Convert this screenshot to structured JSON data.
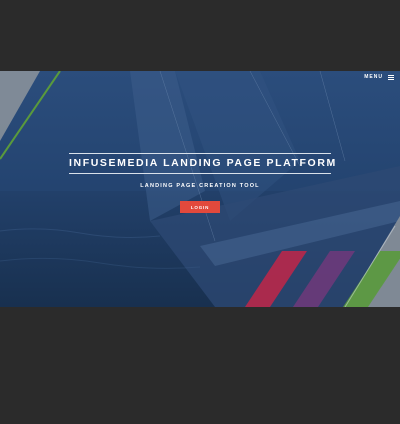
{
  "header": {
    "menu_label": "MENU"
  },
  "hero": {
    "title": "INFUSEMEDIA LANDING PAGE PLATFORM",
    "subtitle": "LANDING PAGE CREATION TOOL",
    "login_label": "LOGIN"
  },
  "icons": {
    "menu": "hamburger-icon"
  },
  "colors": {
    "page_background": "#2b2b2b",
    "hero_overlay": "#1f3a63",
    "accent_login": "#e2493c",
    "stripe_red": "#b8284a",
    "stripe_purple": "#6b3a7a",
    "stripe_green": "#5a9a3c",
    "stripe_grey": "#8e959c"
  }
}
